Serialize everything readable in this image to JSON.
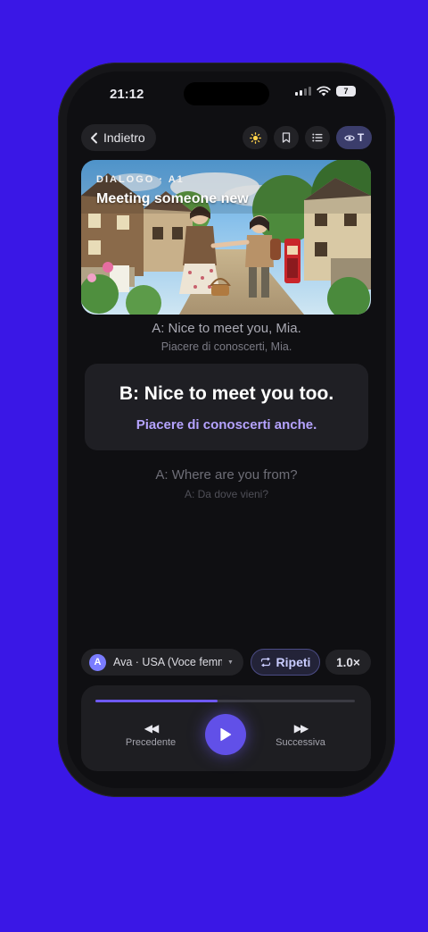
{
  "status": {
    "time": "21:12",
    "battery": "7"
  },
  "nav": {
    "back_label": "Indietro",
    "transcript_toggle": "T"
  },
  "hero": {
    "eyebrow": "DIALOGO · A1",
    "title": "Meeting someone new"
  },
  "dialogue": {
    "previous": {
      "text": "A: Nice to meet you, Mia.",
      "translation": "Piacere di conoscerti, Mia."
    },
    "current": {
      "text": "B: Nice to meet you too.",
      "translation": "Piacere di conoscerti anche."
    },
    "next": {
      "text": "A: Where are you from?",
      "translation": "A: Da dove vieni?"
    }
  },
  "voice": {
    "avatar_letter": "A",
    "label": "Ava · USA (Voce femminile)"
  },
  "controls": {
    "repeat_label": "Ripeti",
    "speed": "1.0×",
    "previous_label": "Precedente",
    "next_label": "Successiva",
    "progress": 0.47
  },
  "colors": {
    "background": "#3a17e6",
    "accent": "#6150e8",
    "accent_text": "#b5a3ff"
  }
}
